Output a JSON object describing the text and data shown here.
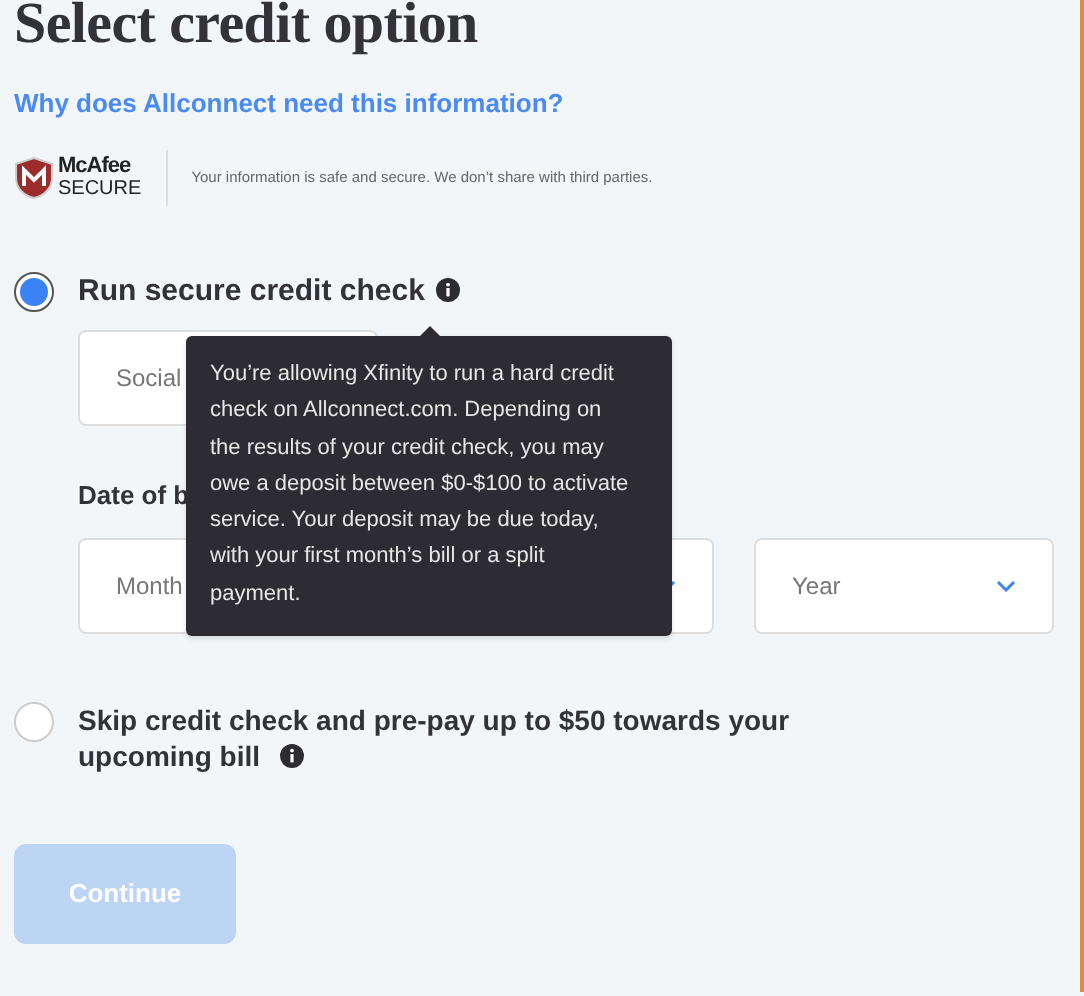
{
  "title": "Select credit option",
  "info_link": "Why does Allconnect need this information?",
  "security": {
    "badge_top": "McAfee",
    "badge_bottom": "SECURE",
    "note": "Your information is safe and secure. We don’t share with third parties."
  },
  "options": [
    {
      "label": "Run secure credit check",
      "selected": true,
      "ssn_placeholder": "Social",
      "dob_label": "Date of b",
      "dob_fields": [
        {
          "kind": "plain",
          "placeholder": "Month"
        },
        {
          "kind": "select"
        },
        {
          "kind": "select",
          "placeholder": "Year"
        }
      ]
    },
    {
      "label": "Skip credit check and pre-pay up to $50 towards your upcoming bill",
      "selected": false
    }
  ],
  "tooltip": "You’re allowing Xfinity to run a hard credit check on Allconnect.com. Depending on the results of your credit check, you may owe a deposit between $0-$100 to activate service. Your deposit may be due today, with your first month’s bill or a split payment.",
  "continue_button": {
    "label": "Continue",
    "disabled": true
  }
}
